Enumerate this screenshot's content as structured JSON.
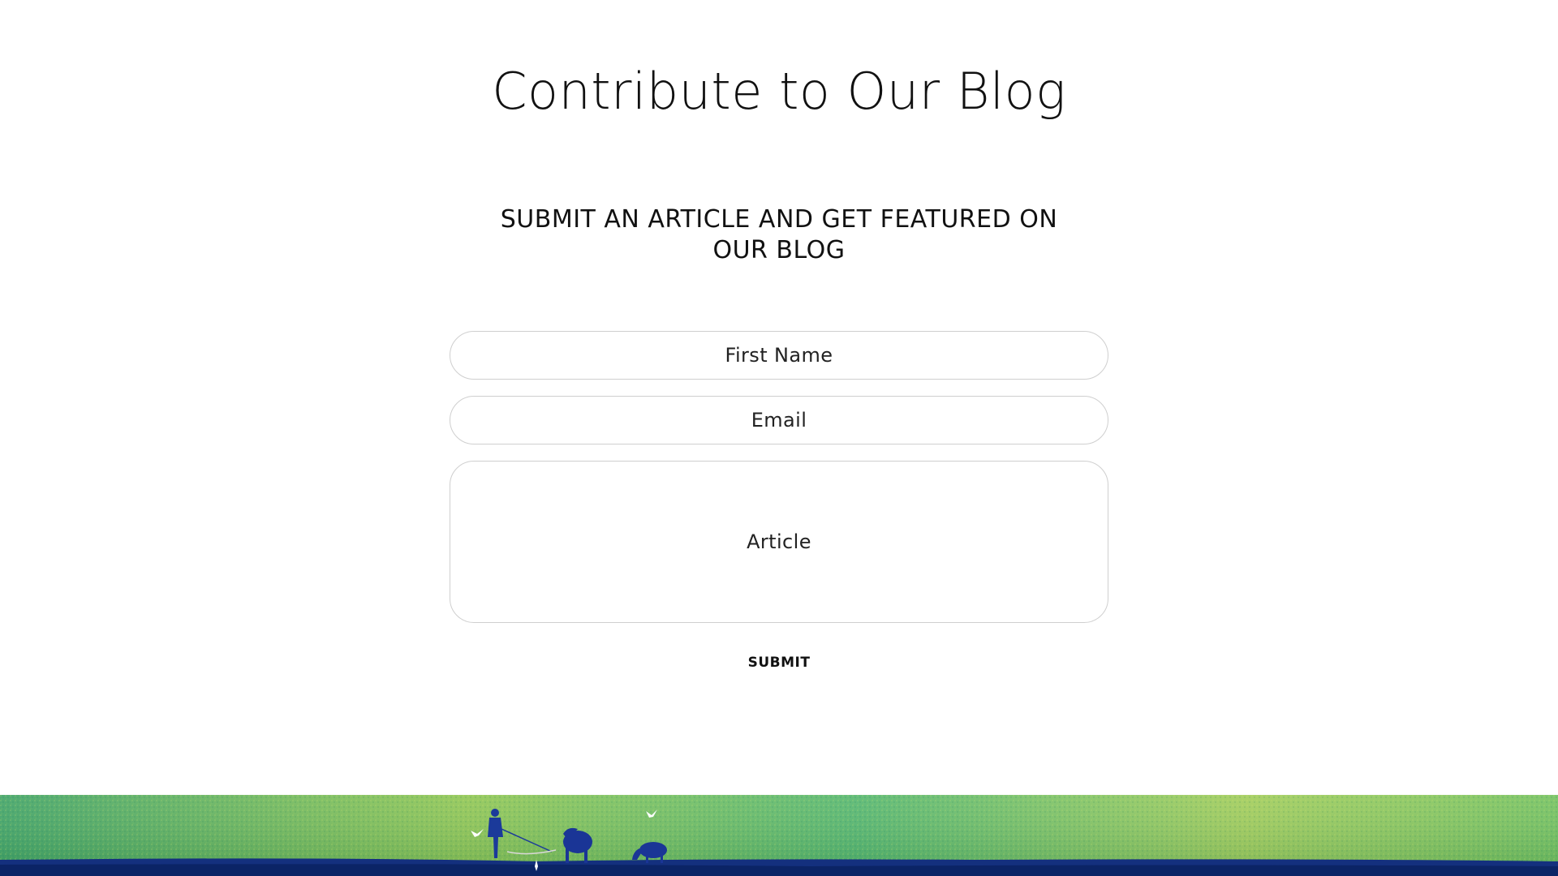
{
  "page": {
    "title": "Contribute to Our Blog",
    "subtitle": "SUBMIT AN ARTICLE AND GET FEATURED ON OUR BLOG"
  },
  "form": {
    "first_name": {
      "placeholder": "First Name",
      "value": ""
    },
    "email": {
      "placeholder": "Email",
      "value": ""
    },
    "article": {
      "placeholder": "Article",
      "value": ""
    },
    "submit_label": "SUBMIT"
  },
  "colors": {
    "background": "#ffffff",
    "text": "#111111",
    "field_border": "#cfcfcf",
    "banner_green_light": "#a6cf52",
    "banner_green": "#3fae5a",
    "banner_blue": "#0e2a7a"
  },
  "banner": {
    "image": "pasture-illustration",
    "figures": [
      "herder",
      "cow",
      "calf",
      "birds"
    ]
  }
}
